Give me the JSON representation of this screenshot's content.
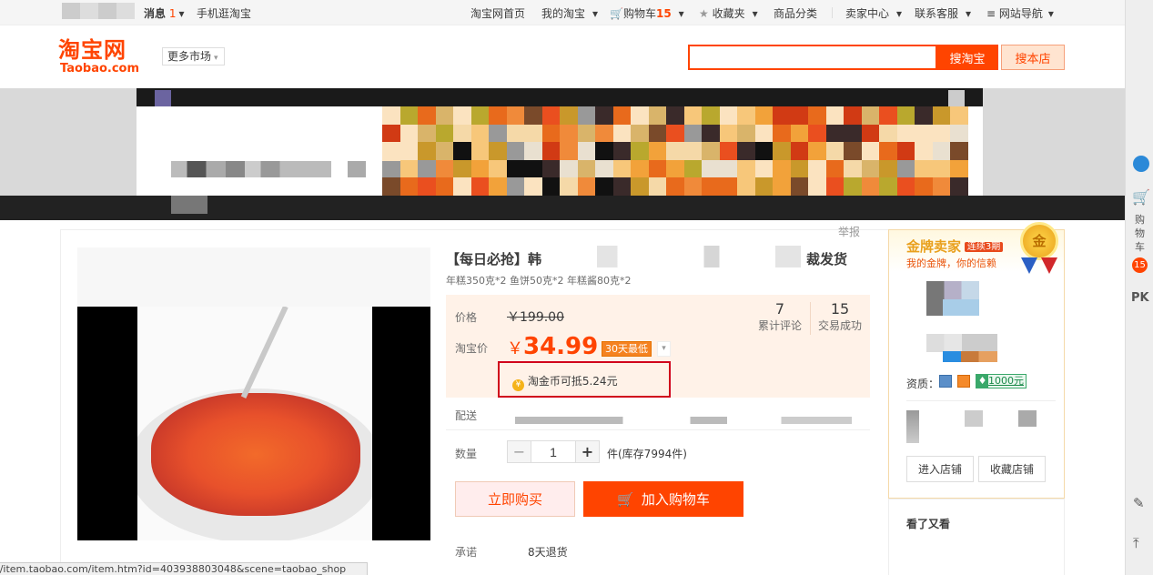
{
  "topbar": {
    "messages_label": "消息",
    "messages_count": "1",
    "mobile_label": "手机逛淘宝",
    "home_label": "淘宝网首页",
    "my_taobao_label": "我的淘宝",
    "cart_label": "购物车",
    "cart_count": "15",
    "favorites_label": "收藏夹",
    "categories_label": "商品分类",
    "seller_center_label": "卖家中心",
    "contact_label": "联系客服",
    "site_nav_label": "网站导航"
  },
  "header": {
    "logo_cn": "淘宝网",
    "logo_en": "Taobao.com",
    "more_markets_label": "更多市场",
    "search_placeholder": "",
    "search_taobao_label": "搜淘宝",
    "search_store_label": "搜本店"
  },
  "right_toolbar": {
    "cart_text": "购物车",
    "cart_count": "15",
    "pk_label": "PK"
  },
  "product": {
    "report_label": "举报",
    "title_start": "【每日必抢】韩",
    "title_end": "裁发货",
    "subtitle": "年糕350克*2 鱼饼50克*2 年糕酱80克*2",
    "price_label": "价格",
    "original_price": "￥199.00",
    "taobao_price_label": "淘宝价",
    "currency_symbol": "￥",
    "current_price": "34.99",
    "lowest_badge": "30天最低",
    "reviews_count": "7",
    "reviews_label": "累计评论",
    "sales_count": "15",
    "sales_label": "交易成功",
    "coin_text_prefix": "淘金币可抵",
    "coin_amount": "5.24元",
    "delivery_label": "配送",
    "quantity_label": "数量",
    "quantity_minus": "−",
    "quantity_value": "1",
    "quantity_plus": "+",
    "stock_text": "件(库存7994件)",
    "buy_now_label": "立即购买",
    "add_to_cart_label": "加入购物车",
    "promise_label": "承诺",
    "promise_value": "8天退货"
  },
  "seller": {
    "gold_title": "金牌卖家",
    "gold_years": "连续3期",
    "gold_slogan": "我的金牌，你的信赖",
    "medal_text": "金",
    "qualification_label": "资质：",
    "deposit_badge": "1000元",
    "enter_store_label": "进入店铺",
    "fav_store_label": "收藏店铺",
    "also_viewed_label": "看了又看"
  },
  "status_bar": {
    "url": "//item.taobao.com/item.htm?id=403938803048&scene=taobao_shop"
  },
  "colors": {
    "brand_orange": "#ff4400",
    "highlight_red": "#d0021b",
    "price_bg": "#fff2e8",
    "gold": "#e9a01d"
  }
}
